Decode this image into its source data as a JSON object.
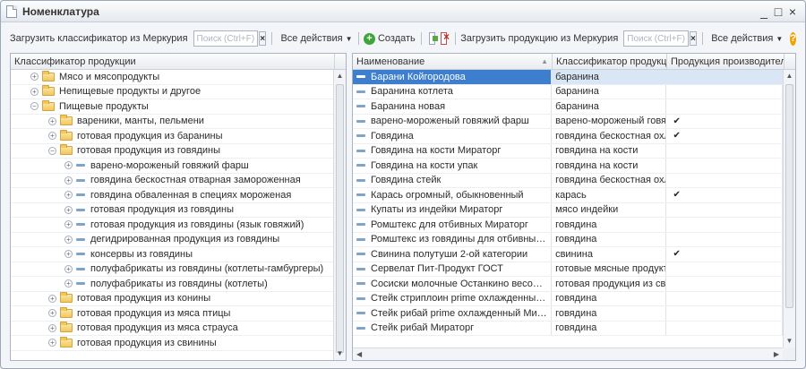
{
  "window": {
    "title": "Номенклатура",
    "minimize": "_",
    "maximize": "□",
    "close": "×"
  },
  "left_toolbar": {
    "load_label": "Загрузить классификатор из Меркурия",
    "search_placeholder": "Поиск (Ctrl+F)",
    "clear": "×",
    "actions_label": "Все действия"
  },
  "right_toolbar": {
    "create_label": "Создать",
    "load_label": "Загрузить продукцию из Меркурия",
    "search_placeholder": "Поиск (Ctrl+F)",
    "clear": "×",
    "actions_label": "Все действия",
    "help": "?"
  },
  "tree": {
    "header": "Классификатор продукции",
    "rows": [
      {
        "level": 1,
        "type": "folder",
        "exp": "+",
        "label": "Мясо и мясопродукты"
      },
      {
        "level": 1,
        "type": "folder",
        "exp": "+",
        "label": "Непищевые продукты и другое"
      },
      {
        "level": 1,
        "type": "folder",
        "exp": "−",
        "label": "Пищевые продукты"
      },
      {
        "level": 2,
        "type": "folder",
        "exp": "+",
        "label": "вареники, манты, пельмени"
      },
      {
        "level": 2,
        "type": "folder",
        "exp": "+",
        "label": "готовая продукция из баранины"
      },
      {
        "level": 2,
        "type": "folder",
        "exp": "−",
        "label": "готовая продукция из говядины"
      },
      {
        "level": 3,
        "type": "item",
        "exp": "+",
        "label": "варено-мороженый говяжий фарш"
      },
      {
        "level": 3,
        "type": "item",
        "exp": "+",
        "label": "говядина бескостная отварная замороженная"
      },
      {
        "level": 3,
        "type": "item",
        "exp": "+",
        "label": "говядина обваленная в специях мороженая"
      },
      {
        "level": 3,
        "type": "item",
        "exp": "+",
        "label": "готовая продукция из говядины"
      },
      {
        "level": 3,
        "type": "item",
        "exp": "+",
        "label": "готовая продукция из говядины (язык говяжий)"
      },
      {
        "level": 3,
        "type": "item",
        "exp": "+",
        "label": "дегидрированная продукция из говядины"
      },
      {
        "level": 3,
        "type": "item",
        "exp": "+",
        "label": "консервы из говядины"
      },
      {
        "level": 3,
        "type": "item",
        "exp": "+",
        "label": "полуфабрикаты из говядины (котлеты-гамбургеры)"
      },
      {
        "level": 3,
        "type": "item",
        "exp": "+",
        "label": "полуфабрикаты из говядины (котлеты)"
      },
      {
        "level": 2,
        "type": "folder",
        "exp": "+",
        "label": "готовая продукция из конины"
      },
      {
        "level": 2,
        "type": "folder",
        "exp": "+",
        "label": "готовая продукция из мяса птицы"
      },
      {
        "level": 2,
        "type": "folder",
        "exp": "+",
        "label": "готовая продукция из мяса страуса"
      },
      {
        "level": 2,
        "type": "folder",
        "exp": "+",
        "label": "готовая продукция из свинины"
      }
    ]
  },
  "table": {
    "headers": {
      "name": "Наименование",
      "classifier": "Классификатор продукции",
      "producer": "Продукция производителя"
    },
    "rows": [
      {
        "name": "Барани Койгородова",
        "classifier": "баранина",
        "producer": ""
      },
      {
        "name": "Баранина котлета",
        "classifier": "баранина",
        "producer": ""
      },
      {
        "name": "Баранина новая",
        "classifier": "баранина",
        "producer": ""
      },
      {
        "name": "варено-мороженый говяжий фарш",
        "classifier": "варено-мороженый говя...",
        "producer": "✔"
      },
      {
        "name": "Говядина",
        "classifier": "говядина бескостная охл...",
        "producer": "✔"
      },
      {
        "name": "Говядина на кости Мираторг",
        "classifier": "говядина на кости",
        "producer": ""
      },
      {
        "name": "Говядина на кости упак",
        "classifier": "говядина на кости",
        "producer": ""
      },
      {
        "name": "Говядина стейк",
        "classifier": "говядина бескостная охл...",
        "producer": ""
      },
      {
        "name": "Карась огромный, обыкновенный",
        "classifier": "карась",
        "producer": "✔"
      },
      {
        "name": "Купаты из индейки Мираторг",
        "classifier": "мясо индейки",
        "producer": ""
      },
      {
        "name": "Ромштекс для отбивных Мираторг",
        "classifier": "говядина",
        "producer": ""
      },
      {
        "name": "Ромштекс из говядины для отбивных Ми...",
        "classifier": "говядина",
        "producer": ""
      },
      {
        "name": "Свинина полутуши 2-ой категории",
        "classifier": "свинина",
        "producer": "✔"
      },
      {
        "name": "Сервелат Пит-Продукт ГОСТ",
        "classifier": "готовые мясные продукты",
        "producer": ""
      },
      {
        "name": "Сосиски молочные Останкино весовые",
        "classifier": "готовая продукция из св...",
        "producer": ""
      },
      {
        "name": "Стейк стриплоин prime охлажденный Мир...",
        "classifier": "говядина",
        "producer": ""
      },
      {
        "name": "Стейк рибай prime охлажденный Мираторг...",
        "classifier": "говядина",
        "producer": ""
      },
      {
        "name": "Стейк рибай Мираторг",
        "classifier": "говядина",
        "producer": ""
      }
    ]
  },
  "colors": {
    "selection": "#3d7ecf",
    "folder": "#f1c75a",
    "item_dash": "#7fa4c9",
    "create_icon": "#3ca63a",
    "help_icon": "#f0a400"
  }
}
